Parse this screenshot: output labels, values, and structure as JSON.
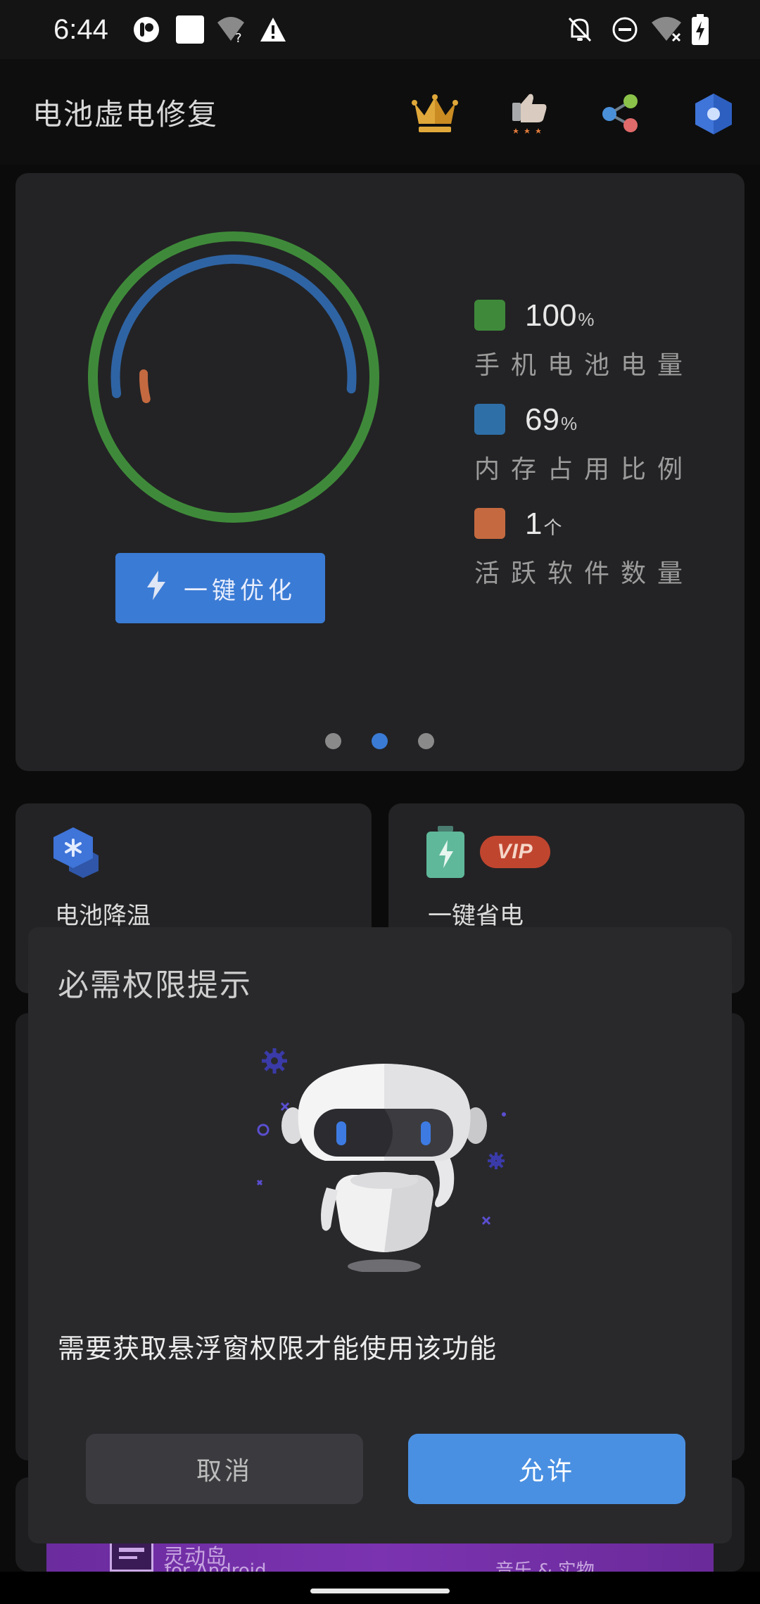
{
  "status_bar": {
    "time": "6:44",
    "left_icons": [
      "app-notification-icon",
      "square-notification-icon",
      "wifi-unknown-icon",
      "warning-icon"
    ],
    "right_icons": [
      "notifications-off-icon",
      "do-not-disturb-icon",
      "wifi-off-icon",
      "battery-charging-icon"
    ]
  },
  "app_bar": {
    "title": "电池虚电修复",
    "actions": [
      "crown-icon",
      "rate-icon",
      "share-icon",
      "settings-icon"
    ]
  },
  "dashboard": {
    "battery": {
      "value": "100",
      "unit": "%",
      "label": "手机电池电量",
      "color": "#3f8a3a",
      "level": 1.0
    },
    "memory": {
      "value": "69",
      "unit": "%",
      "label": "内存占用比例",
      "color": "#2f6fa8",
      "level": 0.69
    },
    "apps": {
      "value": "1",
      "unit": "个",
      "label": "活跃软件数量",
      "color": "#c56a40",
      "level": 0.01
    },
    "optimize_button": "一键优化",
    "page_indicator": {
      "count": 3,
      "active": 1
    }
  },
  "features": {
    "cooling": {
      "label": "电池降温"
    },
    "power_saving": {
      "label": "一键省电",
      "badge": "VIP"
    }
  },
  "dialog": {
    "title": "必需权限提示",
    "message": "需要获取悬浮窗权限才能使用该功能",
    "cancel": "取消",
    "allow": "允许"
  },
  "banner": {
    "title": "灵动岛",
    "subtitle": "for Android",
    "tag": "音乐 & 实物"
  },
  "colors": {
    "accent": "#3a7bd5",
    "allow_button": "#4a90e2",
    "card_background": "#232325",
    "dialog_background": "#29292c"
  }
}
